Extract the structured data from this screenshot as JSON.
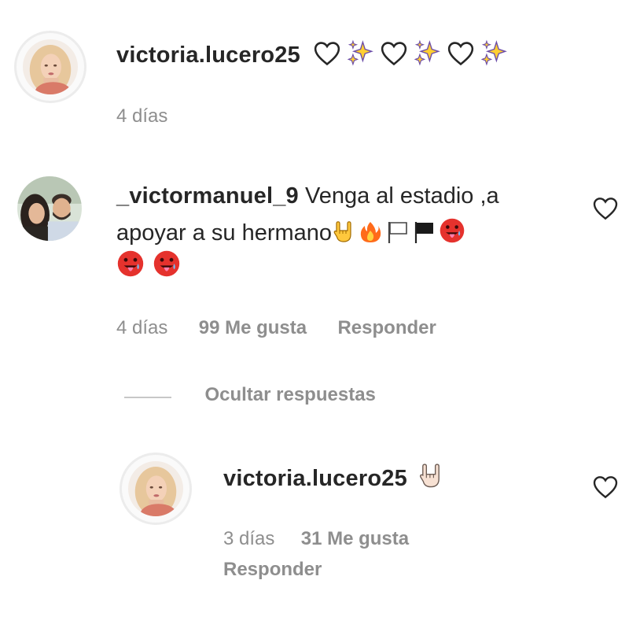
{
  "comments": [
    {
      "username": "victoria.lucero25",
      "emoji_icons": [
        "white-heart-icon",
        "sparkles-icon",
        "white-heart-icon",
        "sparkles-icon",
        "white-heart-icon",
        "sparkles-icon"
      ],
      "time": "4 días"
    },
    {
      "username": "_victormanuel_9",
      "text_line1": "Venga al estadio ,a",
      "text_line2": "apoyar a su hermano",
      "emoji_icons_line2": [
        "rock-hand-icon",
        "fire-icon",
        "white-flag-icon",
        "black-flag-icon",
        "hot-face-icon"
      ],
      "emoji_icons_line3": [
        "hot-face-icon",
        "hot-face-icon"
      ],
      "time": "4 días",
      "likes": "99 Me gusta",
      "reply_label": "Responder",
      "toggle_replies_label": "Ocultar respuestas"
    }
  ],
  "reply": {
    "username": "victoria.lucero25",
    "emoji_icons": [
      "rock-hand-icon"
    ],
    "time": "3 días",
    "likes": "31 Me gusta",
    "reply_label": "Responder"
  },
  "colors": {
    "text": "#262626",
    "muted": "#8e8e8e",
    "divider": "#c7c7c7"
  }
}
